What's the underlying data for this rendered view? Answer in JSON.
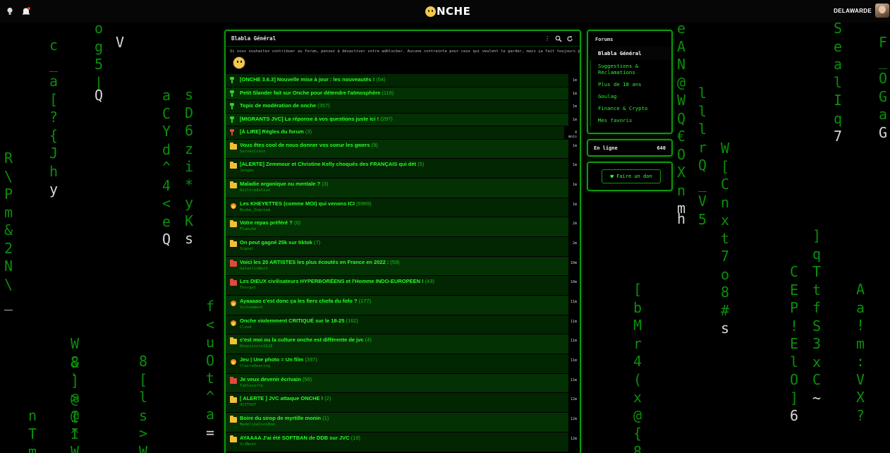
{
  "header": {
    "logo": "ONCHE",
    "username": "DELAWARDE",
    "icons": [
      "bulb-icon",
      "bell-icon"
    ]
  },
  "colors": {
    "accent": "#0c9a0c",
    "topic_title": "#27ff27",
    "pin": "#2cd12c",
    "alert_pin": "#e04343",
    "folder": "#f2c037"
  },
  "rain_columns": [
    {
      "text": "o\ng\n5\n|",
      "hi": ""
    },
    {
      "text": "V",
      "hi": "V"
    },
    {
      "text": "c\n\n_\na\n[\n?\n{\nJ\nh\ny",
      "hi": "y"
    },
    {
      "text": "Q",
      "hi": "Q"
    },
    {
      "text": "a\nC\nY\nd\n^\n4\n<\ne\nQ",
      "hi": "Q"
    },
    {
      "text": "s\nD\n6\nz\ni\n*\ny\nK\ns",
      "hi": "s"
    },
    {
      "text": "R\n\\\nP\nm\n&\n2\nN\n\\\n_",
      "hi": "_"
    },
    {
      "text": "f\n<\nu\nO\nt\n^\na\n=",
      "hi": "="
    },
    {
      "text": "W\n8\n`\n>\n@\nI\nW",
      "hi": ""
    },
    {
      "text": "8\n[\nl\ns\n>\nW",
      "hi": ""
    },
    {
      "text": "n\nT\nm",
      "hi": ""
    },
    {
      "text": "&\n]\n@\nI\n^",
      "hi": ""
    },
    {
      "text": "e\nA\nN\n@\nW\nQ\n€\nO\nX\nn\nm",
      "hi": "m"
    },
    {
      "text": "h",
      "hi": "h"
    },
    {
      "text": "l\nl\nl\nr\nQ\n_\nV\n5",
      "hi": ""
    },
    {
      "text": "W\n[\nC\nn\nx\nt\n7\no\n8\n#\ns",
      "hi": "s"
    },
    {
      "text": "[\nb\nM\nr\n4\n(\nx\n@\n{\n8",
      "hi": ""
    },
    {
      "text": "C\nE\nP\n!\nE\nl\nO\n]\n6",
      "hi": "6"
    },
    {
      "text": "S\ne\na\nl\nI\nq\n7",
      "hi": "7"
    },
    {
      "text": "]\nq\nT\nt\nf\nS\n3\nx\nC\n~",
      "hi": "~"
    },
    {
      "text": "F\n_\nO\nG\na\nG",
      "hi": "G"
    },
    {
      "text": "A\na\n!\nm\n:\nV\nX\n?",
      "hi": ""
    }
  ],
  "main": {
    "title": "Blabla Général",
    "notice": "Si vous souhaitez contribuer au forum, pensez à désactiver votre adblocker. Aucune contrainte pour ceux qui veulent le garder, mais ça fait toujours plaisir !",
    "topics": [
      {
        "icon": "pin",
        "title": "[ONCHE 3.6.3] Nouvelle mise à jour : les nouveautés !",
        "count": "(64)",
        "author": "",
        "time": "1m"
      },
      {
        "icon": "pin",
        "title": "Petit Slander fait sur Onche pour détendre l'atmosphère",
        "count": "(116)",
        "author": "",
        "time": "1m"
      },
      {
        "icon": "pin",
        "title": "Topic de modération de onche",
        "count": "(357)",
        "author": "",
        "time": "1m"
      },
      {
        "icon": "pin",
        "title": "[MIGRANTS JVC] La réponse à vos questions juste ici !",
        "count": "(297)",
        "author": "",
        "time": "1m"
      },
      {
        "icon": "pin-red",
        "title": "[À LIRE] Règles du forum",
        "count": "(3)",
        "author": "",
        "time": "4 mois"
      },
      {
        "icon": "folder",
        "title": "Vous êtes cool de nous donner vos soeur les gwers",
        "count": "(9)",
        "author": "SurvetCroco",
        "time": "1m"
      },
      {
        "icon": "folder",
        "title": "[ALERTE] Zemmour et Christine Kelly choqués des FRANÇAIS qui dét",
        "count": "(5)",
        "author": "Jungko",
        "time": "1m"
      },
      {
        "icon": "folder",
        "title": "Maladie organique ou mentale ?",
        "count": "(3)",
        "author": "Ouiltredution",
        "time": "1m"
      },
      {
        "icon": "fire",
        "title": "Les KHEYETTES (comme MOI) qui venons ICI",
        "count": "(6969)",
        "author": "Boube_Ingroum",
        "time": "1m"
      },
      {
        "icon": "folder",
        "title": "Votre repas préféré ?",
        "count": "(0)",
        "author": "Flanche",
        "time": "2m"
      },
      {
        "icon": "folder",
        "title": "On peut gagné 25k sur tiktok",
        "count": "(7)",
        "author": "Signal",
        "time": "2m"
      },
      {
        "icon": "folder-red",
        "title": "Voici les 20 ARTISTES les plus écoutés en France en 2022 :",
        "count": "(59)",
        "author": "GalacticWars",
        "time": "10m"
      },
      {
        "icon": "folder-red",
        "title": "Les DIEUX civilisateurs HYPERBORÉENS et l'Homme INDO-EUROPEEN !",
        "count": "(43)",
        "author": "Thorgal",
        "time": "10m"
      },
      {
        "icon": "fire",
        "title": "Ayaaaao c'est donc ça les fiers chofa du fofo ?",
        "count": "(177)",
        "author": "Violemment",
        "time": "11m"
      },
      {
        "icon": "fire",
        "title": "Onche violemment CRITIQUÉ sur le 18-25",
        "count": "(162)",
        "author": "Cloud",
        "time": "11m"
      },
      {
        "icon": "folder",
        "title": "c'est moi ou la culture onche est différente de jvc",
        "count": "(4)",
        "author": "Kheyzinzin1628",
        "time": "11m"
      },
      {
        "icon": "fire",
        "title": "Jeu | Une photo = Un film",
        "count": "(397)",
        "author": "ClaireDearing",
        "time": "11m"
      },
      {
        "icon": "folder-red",
        "title": "Je veux devenir écrivain",
        "count": "(56)",
        "author": "Tableverte",
        "time": "11m"
      },
      {
        "icon": "folder",
        "title": "[ ALERTE ] JVC attaque ONCHE !",
        "count": "(2)",
        "author": "OUITOUT",
        "time": "12m"
      },
      {
        "icon": "folder",
        "title": "Boire du sirop de myrtille monin",
        "count": "(1)",
        "author": "MadelineCocoDom",
        "time": "12m"
      },
      {
        "icon": "folder",
        "title": "AYAAAA J'ai été SOFTBAN de DDB sur JVC",
        "count": "(19)",
        "author": "Sc3Nodt",
        "time": "12m"
      }
    ]
  },
  "sidebar": {
    "forums_title": "Forums",
    "items": [
      {
        "label": "Blabla Général",
        "active": true
      },
      {
        "label": "Suggestions & Réclamations",
        "active": false
      },
      {
        "label": "Plus de 18 ans",
        "active": false
      },
      {
        "label": "Goulag",
        "active": false
      },
      {
        "label": "Finance & Crypto",
        "active": false
      },
      {
        "label": "Mes favoris",
        "active": false
      }
    ],
    "online_label": "En ligne",
    "online_count": "640",
    "donate_label": "Faire un don"
  }
}
